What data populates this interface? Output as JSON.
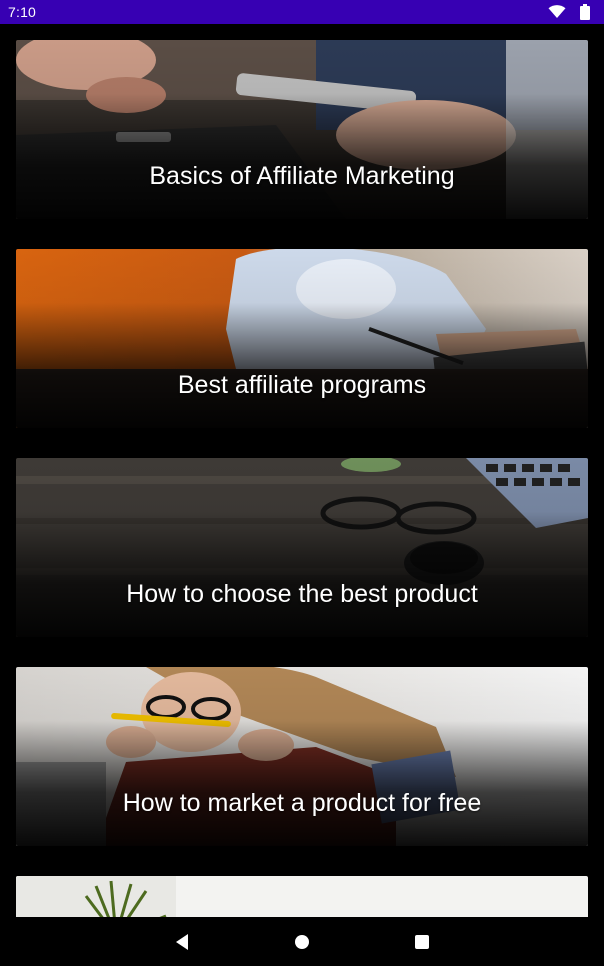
{
  "status_bar": {
    "time": "7:10",
    "icons": [
      "wifi-icon",
      "battery-icon"
    ],
    "color": "#3700b3"
  },
  "topics": [
    {
      "title": "Basics of Affiliate Marketing",
      "image": "hands-holding-phone-on-laptop"
    },
    {
      "title": "Best affiliate programs",
      "image": "man-writing-at-laptop"
    },
    {
      "title": "How to choose the best product",
      "image": "desk-with-glasses-coffee-laptop"
    },
    {
      "title": "How to market a product for free",
      "image": "woman-biting-pencil"
    },
    {
      "title": "",
      "image": "plant-on-white-desk"
    }
  ],
  "nav_bar": {
    "icons": [
      "back-icon",
      "home-icon",
      "recents-icon"
    ]
  }
}
